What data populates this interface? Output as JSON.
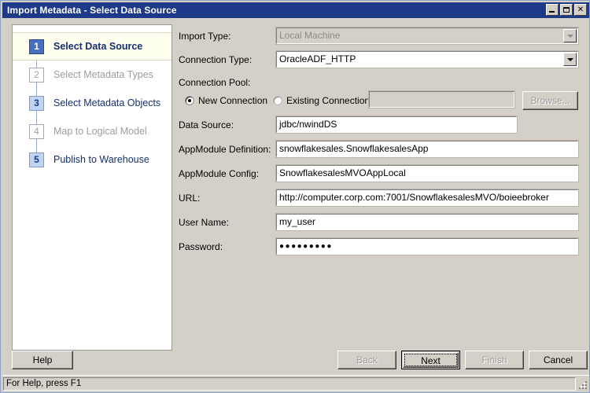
{
  "window": {
    "title": "Import Metadata - Select Data Source",
    "minimize_label": "Minimize",
    "maximize_label": "Maximize",
    "close_label": "✕"
  },
  "steps": [
    {
      "number": "1",
      "label": "Select Data Source",
      "state": "active"
    },
    {
      "number": "2",
      "label": "Select Metadata Types",
      "state": "disabled"
    },
    {
      "number": "3",
      "label": "Select Metadata Objects",
      "state": "enabled"
    },
    {
      "number": "4",
      "label": "Map to Logical Model",
      "state": "disabled"
    },
    {
      "number": "5",
      "label": "Publish to Warehouse",
      "state": "enabled"
    }
  ],
  "form": {
    "import_type": {
      "label": "Import Type:",
      "value": "Local Machine",
      "enabled": false
    },
    "connection_type": {
      "label": "Connection Type:",
      "value": "OracleADF_HTTP",
      "enabled": true
    },
    "connection_pool": {
      "label": "Connection Pool:"
    },
    "new_connection": {
      "label": "New Connection",
      "checked": true
    },
    "existing_connection": {
      "label": "Existing Connection",
      "checked": false
    },
    "existing_connection_value": "",
    "browse": {
      "label": "Browse...",
      "enabled": false
    },
    "data_source": {
      "label": "Data Source:",
      "value": "jdbc/nwindDS"
    },
    "appmodule_definition": {
      "label": "AppModule Definition:",
      "value": "snowflakesales.SnowflakesalesApp"
    },
    "appmodule_config": {
      "label": "AppModule Config:",
      "value": "SnowflakesalesMVOAppLocal"
    },
    "url": {
      "label": "URL:",
      "value": "http://computer.corp.com:7001/SnowflakesalesMVO/boieebroker"
    },
    "user_name": {
      "label": "User Name:",
      "value": "my_user"
    },
    "password": {
      "label": "Password:",
      "value": "●●●●●●●●●"
    }
  },
  "buttons": {
    "help": "Help",
    "back": "Back",
    "next": "Next",
    "finish": "Finish",
    "cancel": "Cancel"
  },
  "statusbar": {
    "text": "For Help, press F1"
  },
  "colors": {
    "titlebar": "#1c3a87",
    "face": "#d4d0c8",
    "active_step_bg": "#fffff0",
    "step_accent": "#4a6fbe",
    "step_enabled_box": "#bfd5f2",
    "step_text": "#16306e"
  }
}
